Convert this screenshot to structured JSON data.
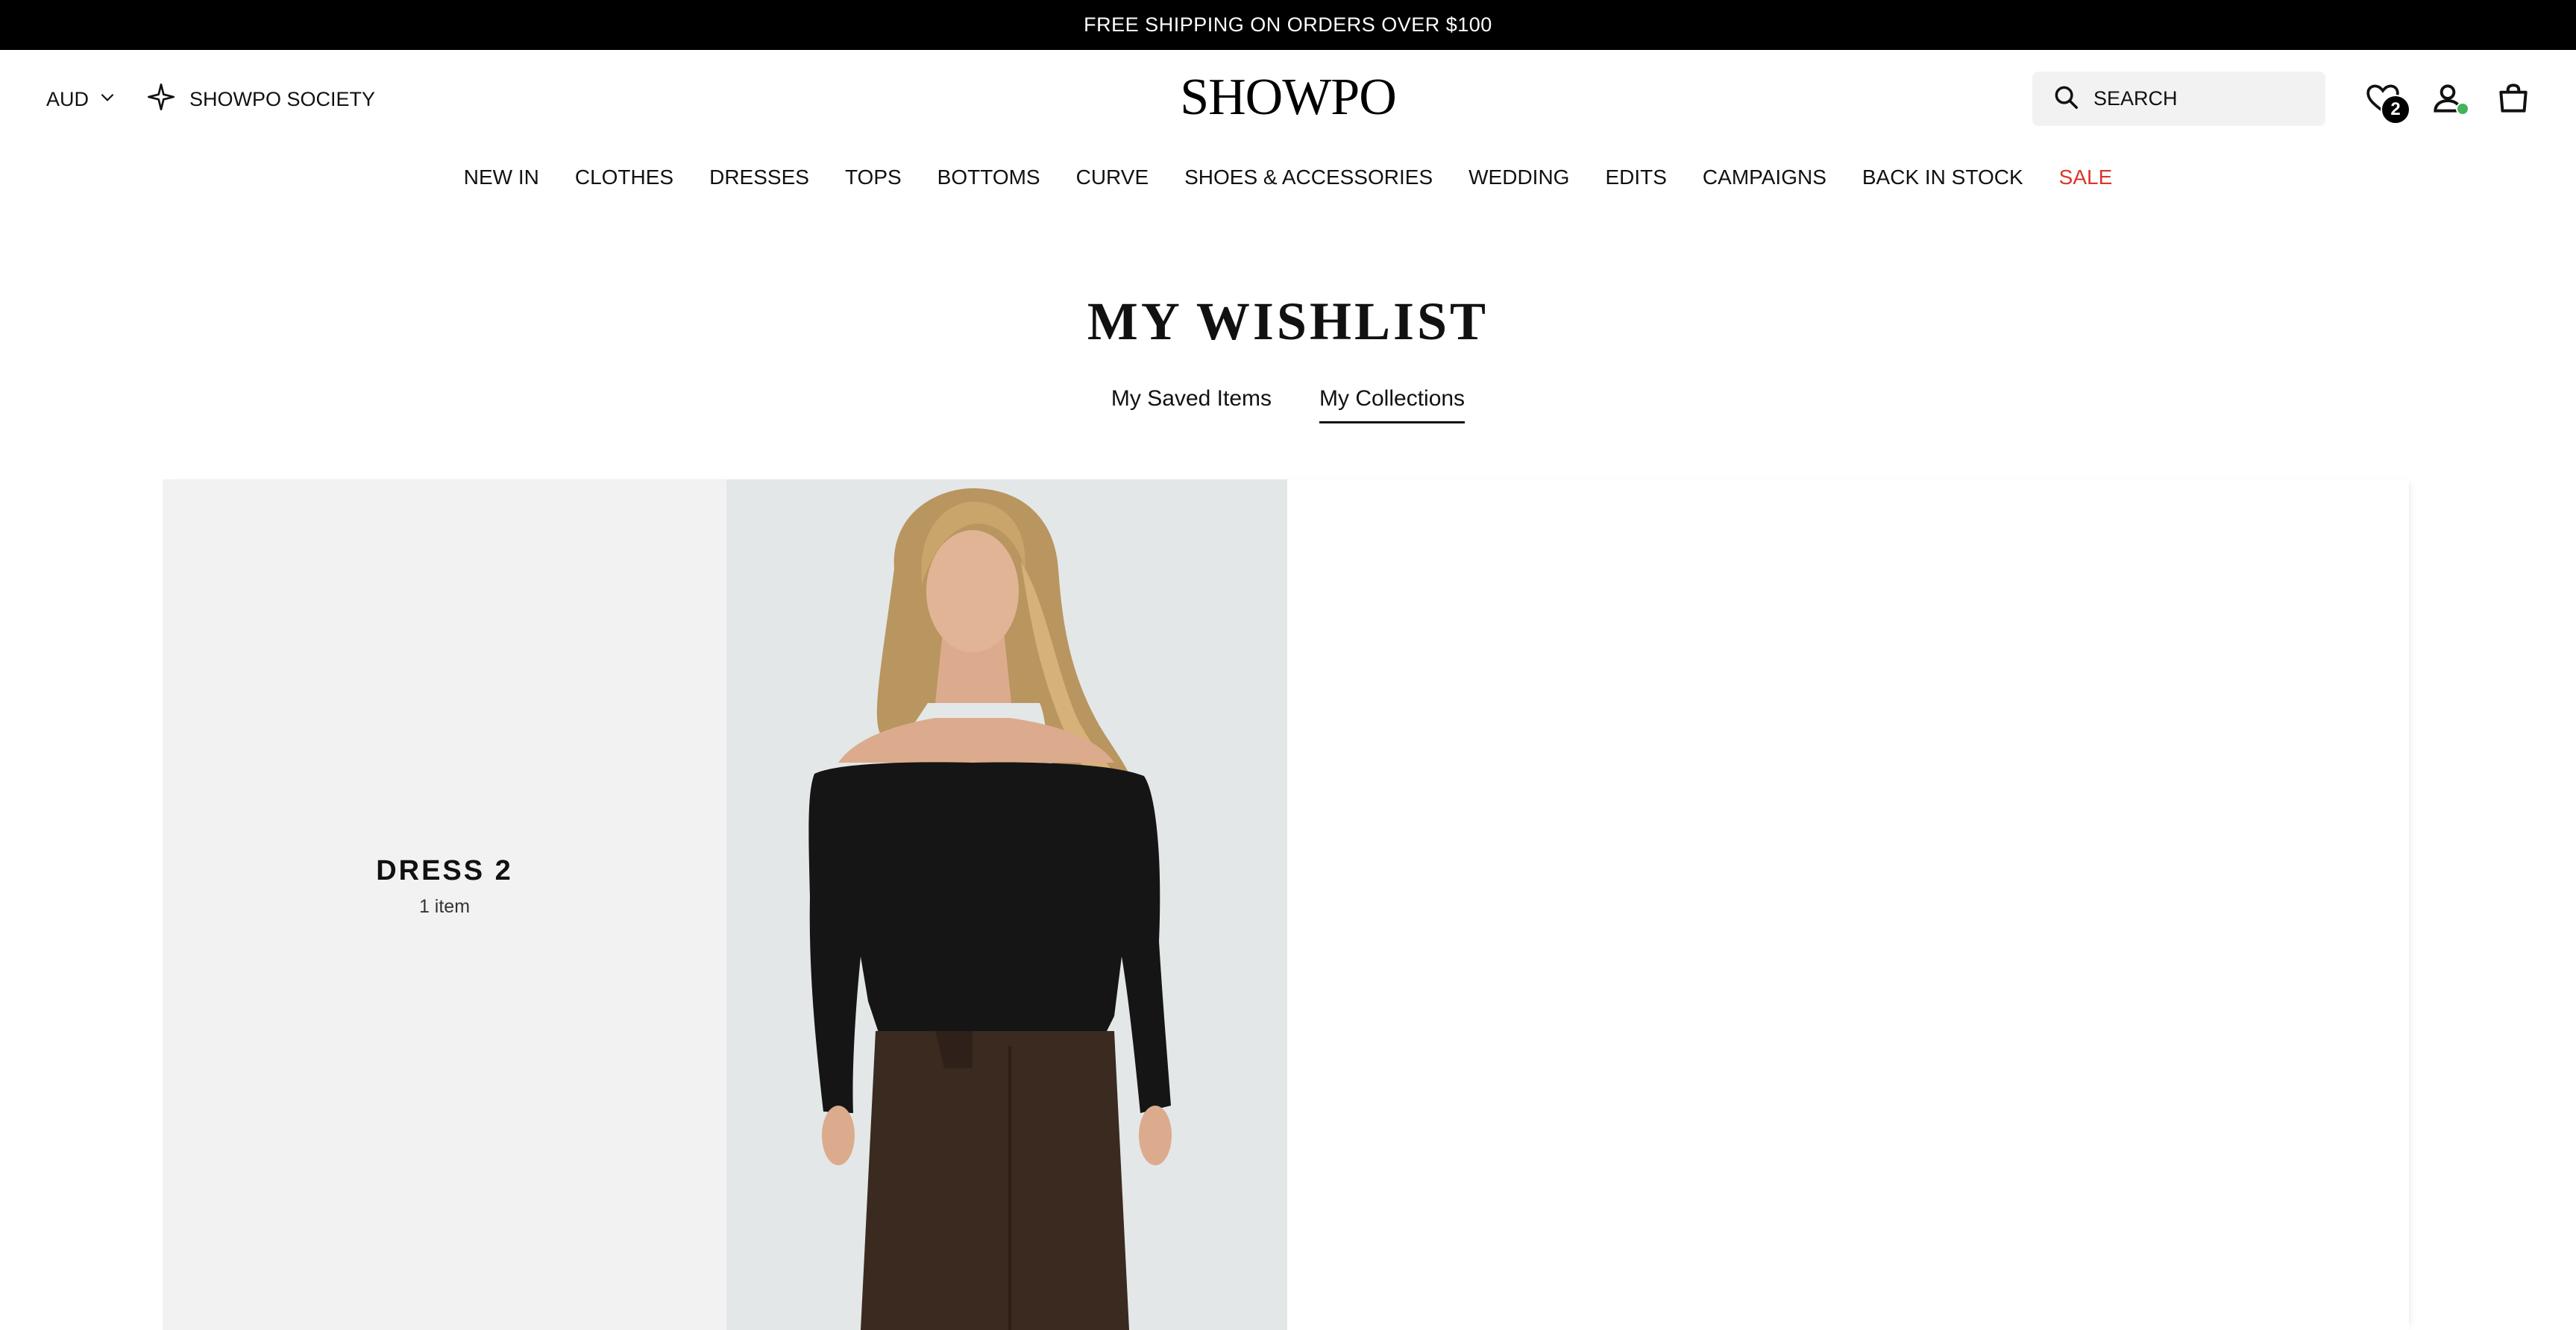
{
  "announcement": "FREE SHIPPING ON ORDERS OVER $100",
  "header": {
    "currency": "AUD",
    "society": "SHOWPO SOCIETY",
    "logo": "SHOWPO",
    "search_placeholder": "SEARCH",
    "wishlist_count": "2",
    "icons": [
      "chevron-down-icon",
      "sparkle-icon",
      "search-icon",
      "heart-icon",
      "user-icon",
      "bag-icon"
    ]
  },
  "nav": {
    "items": [
      "NEW IN",
      "CLOTHES",
      "DRESSES",
      "TOPS",
      "BOTTOMS",
      "CURVE",
      "SHOES & ACCESSORIES",
      "WEDDING",
      "EDITS",
      "CAMPAIGNS",
      "BACK IN STOCK"
    ],
    "sale": "SALE",
    "sale_color": "#d9372b"
  },
  "page": {
    "title": "MY WISHLIST",
    "tabs": [
      "My Saved Items",
      "My Collections"
    ],
    "active_tab": "My Collections"
  },
  "collections": [
    {
      "name": "DRESS 2",
      "count": "1 item"
    }
  ],
  "colors": {
    "announcement_bg": "#000000",
    "card_bg": "#f2f2f2",
    "online": "#44b35a"
  }
}
